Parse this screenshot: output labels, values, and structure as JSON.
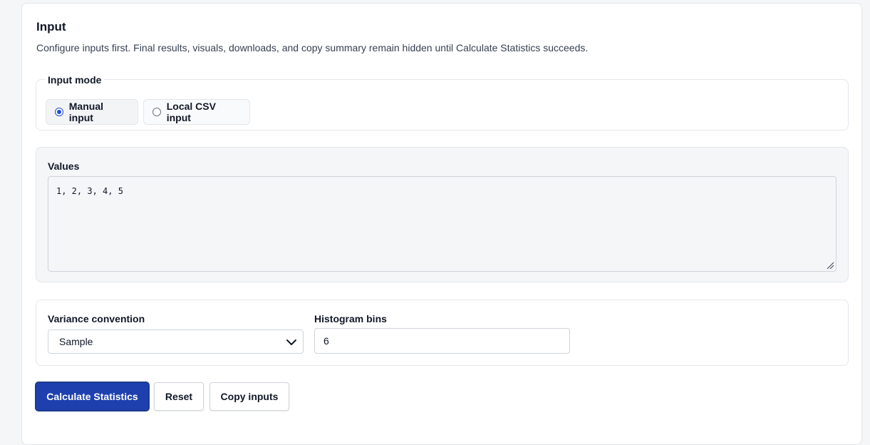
{
  "section": {
    "title": "Input",
    "description": "Configure inputs first. Final results, visuals, downloads, and copy summary remain hidden until Calculate Statistics succeeds."
  },
  "input_mode": {
    "legend": "Input mode",
    "options": [
      {
        "label": "Manual input",
        "selected": true
      },
      {
        "label": "Local CSV input",
        "selected": false
      }
    ]
  },
  "values": {
    "label": "Values",
    "text": "1, 2, 3, 4, 5"
  },
  "options": {
    "variance_label": "Variance convention",
    "variance_value": "Sample",
    "bins_label": "Histogram bins",
    "bins_value": "6"
  },
  "actions": {
    "calculate": "Calculate Statistics",
    "reset": "Reset",
    "copy": "Copy inputs"
  },
  "colors": {
    "accent": "#1e40af",
    "radio": "#1d4ed8"
  }
}
